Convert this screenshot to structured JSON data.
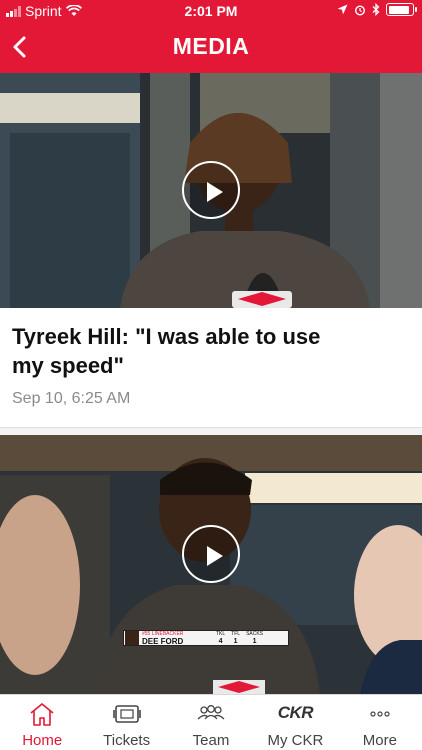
{
  "status_bar": {
    "carrier": "Sprint",
    "time": "2:01 PM"
  },
  "header": {
    "title": "MEDIA"
  },
  "feed": [
    {
      "headline": "Tyreek Hill: \"I was able to use my speed\"",
      "date": "Sep 10, 6:25 AM"
    },
    {
      "lower_third": {
        "role": "#55 LINEBACKER",
        "name": "DEE FORD",
        "stats": [
          {
            "label": "TKL",
            "value": "4"
          },
          {
            "label": "TFL",
            "value": "1"
          },
          {
            "label": "SACKS",
            "value": "1"
          }
        ]
      }
    }
  ],
  "tab_bar": {
    "items": [
      {
        "label": "Home",
        "icon": "home-icon",
        "active": true
      },
      {
        "label": "Tickets",
        "icon": "ticket-icon",
        "active": false
      },
      {
        "label": "Team",
        "icon": "team-icon",
        "active": false
      },
      {
        "label": "My CKR",
        "icon": "ckr-logo-icon",
        "active": false
      },
      {
        "label": "More",
        "icon": "more-dots-icon",
        "active": false
      }
    ],
    "ckr_logo_text": "CKR"
  },
  "colors": {
    "brand_red": "#e31837",
    "text_dark": "#111111",
    "text_muted": "#8a8a8a"
  }
}
